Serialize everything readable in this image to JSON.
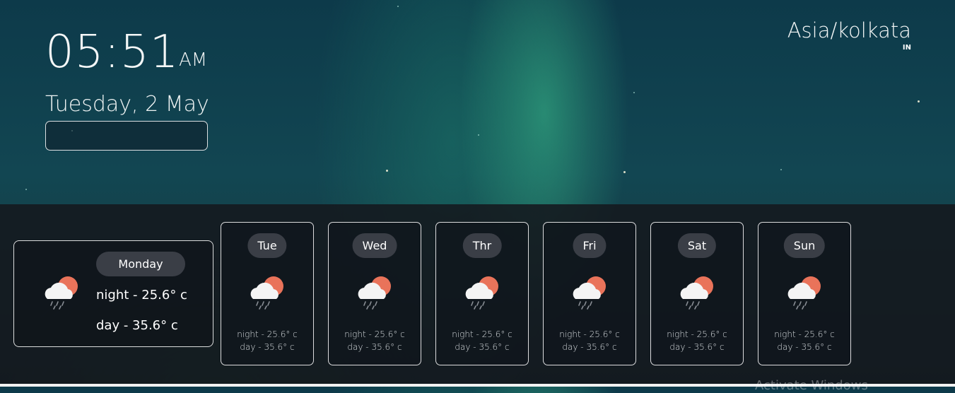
{
  "clock": {
    "time": "05:51",
    "ampm": "AM",
    "date": "Tuesday, 2 May"
  },
  "timezone": {
    "name": "Asia/kolkata",
    "code": "IN"
  },
  "today": {
    "day": "Monday",
    "night": "night - 25.6° c",
    "day_temp": "day - 35.6° c",
    "icon": "cloud-sun-rain-icon"
  },
  "forecast": [
    {
      "day": "Tue",
      "night": "night - 25.6° c",
      "day_temp": "day - 35.6° c",
      "icon": "cloud-sun-rain-icon"
    },
    {
      "day": "Wed",
      "night": "night - 25.6° c",
      "day_temp": "day - 35.6° c",
      "icon": "cloud-sun-rain-icon"
    },
    {
      "day": "Thr",
      "night": "night - 25.6° c",
      "day_temp": "day - 35.6° c",
      "icon": "cloud-sun-rain-icon"
    },
    {
      "day": "Fri",
      "night": "night - 25.6° c",
      "day_temp": "day - 35.6° c",
      "icon": "cloud-sun-rain-icon"
    },
    {
      "day": "Sat",
      "night": "night - 25.6° c",
      "day_temp": "day - 35.6° c",
      "icon": "cloud-sun-rain-icon"
    },
    {
      "day": "Sun",
      "night": "night - 25.6° c",
      "day_temp": "day - 35.6° c",
      "icon": "cloud-sun-rain-icon"
    }
  ],
  "watermark": "Activate Windows",
  "colors": {
    "sun": "#e9735a",
    "cloud": "#f4f4f4",
    "pill": "#3a3e46"
  }
}
